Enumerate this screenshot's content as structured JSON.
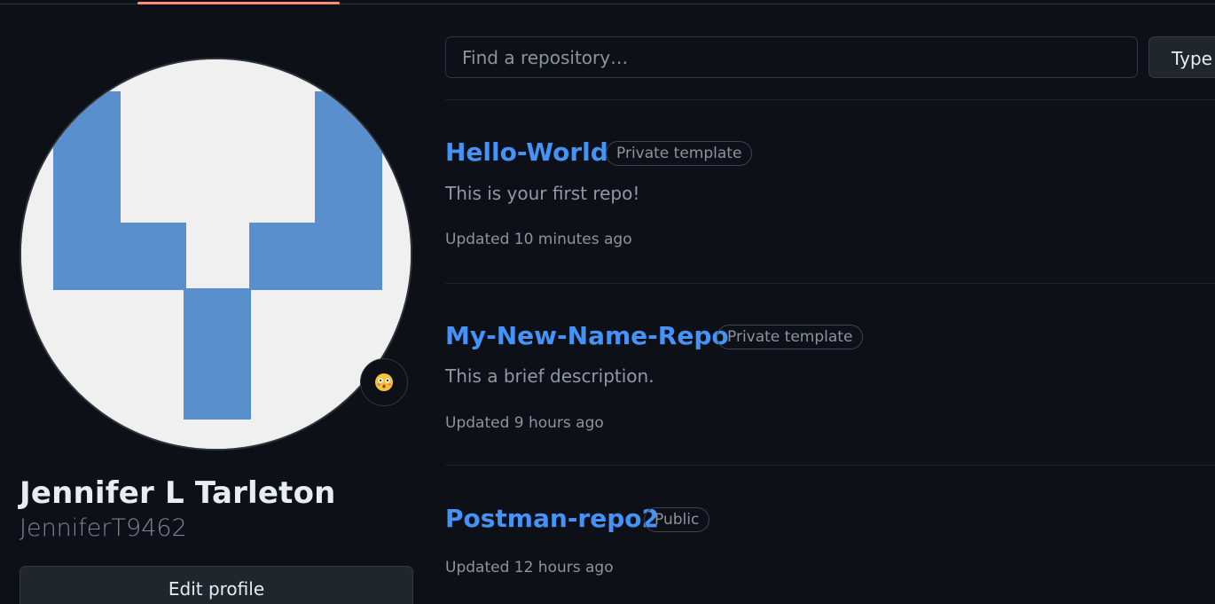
{
  "nav": {
    "active_tab_accent": "#fd8c73"
  },
  "profile": {
    "full_name": "Jennifer L Tarleton",
    "username": "JenniferT9462",
    "edit_profile_label": "Edit profile",
    "status_emoji": "😳",
    "avatar_colors": {
      "foreground": "#5a8fce",
      "background": "#f0f0f0"
    }
  },
  "repo_filter": {
    "search_placeholder": "Find a repository…",
    "type_label": "Type"
  },
  "repositories": [
    {
      "name": "Hello-World",
      "visibility": "Private template",
      "description": "This is your first repo!",
      "updated": "Updated 10 minutes ago"
    },
    {
      "name": "My-New-Name-Repo",
      "visibility": "Private template",
      "description": "This a brief description.",
      "updated": "Updated 9 hours ago"
    },
    {
      "name": "Postman-repo2",
      "visibility": "Public",
      "description": "",
      "updated": "Updated 12 hours ago"
    }
  ],
  "colors": {
    "link": "#4493f8",
    "background": "#0d1117",
    "muted_text": "#8b949e"
  }
}
